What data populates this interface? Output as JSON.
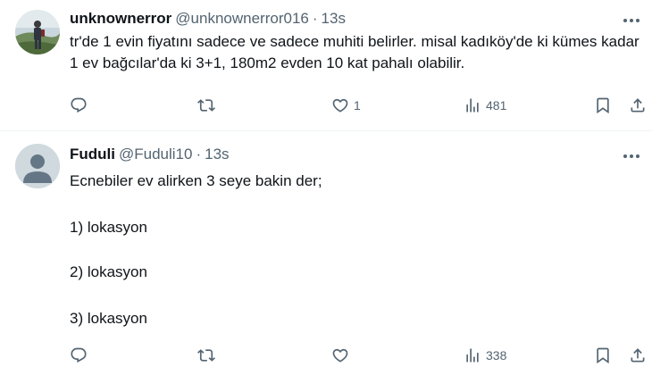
{
  "tweets": [
    {
      "display_name": "unknownerror",
      "handle": "@unknownerror016",
      "separator": "·",
      "time": "13s",
      "text": "tr'de 1 evin fiyatını sadece ve sadece muhiti belirler. misal kadıköy'de ki kümes kadar 1 ev bağcılar'da ki 3+1, 180m2 evden 10 kat pahalı olabilir.",
      "likes": "1",
      "views": "481"
    },
    {
      "display_name": "Fuduli",
      "handle": "@Fuduli10",
      "separator": "·",
      "time": "13s",
      "lines": [
        "Ecnebiler ev alirken 3 seye bakin der;",
        "1) lokasyon",
        "2) lokasyon",
        "3) lokasyon"
      ],
      "views": "338"
    }
  ]
}
